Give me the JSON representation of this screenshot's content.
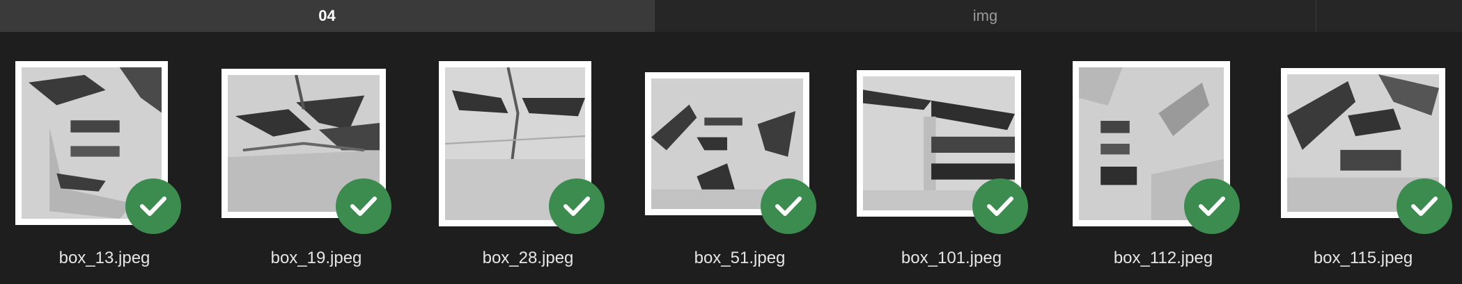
{
  "tabs": [
    {
      "label": "04",
      "active": true
    },
    {
      "label": "img",
      "active": false
    }
  ],
  "files": [
    {
      "name": "box_13.jpeg",
      "checked": true
    },
    {
      "name": "box_19.jpeg",
      "checked": true
    },
    {
      "name": "box_28.jpeg",
      "checked": true
    },
    {
      "name": "box_51.jpeg",
      "checked": true
    },
    {
      "name": "box_101.jpeg",
      "checked": true
    },
    {
      "name": "box_112.jpeg",
      "checked": true
    },
    {
      "name": "box_115.jpeg",
      "checked": true
    }
  ],
  "colors": {
    "background": "#1e1e1e",
    "active_tab": "#3a3a3a",
    "check_badge": "#3c8b4f"
  },
  "icons": {
    "badge": "checkmark-icon"
  }
}
